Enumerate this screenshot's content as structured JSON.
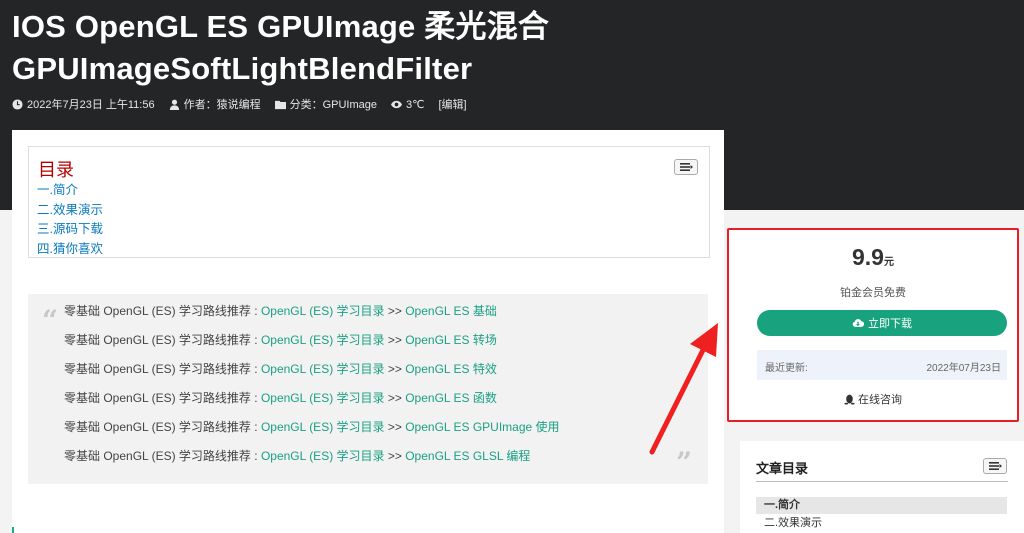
{
  "article": {
    "title_line1": "IOS OpenGL ES GPUImage 柔光混合",
    "title_line2": "GPUImageSoftLightBlendFilter",
    "meta": {
      "date": "2022年7月23日 上午11:56",
      "author": "作者：猿说编程",
      "category": "分类：GPUImage",
      "views": "3℃",
      "edit": "[编辑]"
    }
  },
  "toc": {
    "title": "目录",
    "items": [
      "一.简介",
      "二.效果演示",
      "三.源码下载",
      "四.猜你喜欢"
    ]
  },
  "quote": {
    "prefix": "零基础 OpenGL (ES) 学习路线推荐 : ",
    "link_main": "OpenGL (ES) 学习目录",
    "separator": " >> ",
    "lines": [
      "OpenGL ES 基础",
      "OpenGL ES 转场",
      "OpenGL ES 特效",
      "OpenGL ES 函数",
      "OpenGL ES GPUImage 使用",
      "OpenGL ES GLSL 编程"
    ]
  },
  "widget": {
    "price": "9.9",
    "currency": "元",
    "price_note": "铂金会员免费",
    "download_label": "立即下载",
    "update_label": "最近更新:",
    "update_value": "2022年07月23日",
    "consult_label": "在线咨询"
  },
  "sidebar_toc": {
    "title": "文章目录",
    "items": [
      "一.简介",
      "二.效果演示"
    ]
  },
  "icons": {
    "date": "clock-icon",
    "author": "user-icon",
    "category": "folder-icon",
    "views": "eye-icon",
    "download": "cloud-download-icon",
    "consult": "qq-penguin-icon",
    "toggle": "list-toggle-icon"
  },
  "colors": {
    "header_bg": "#232526",
    "link_blue": "#0a7abf",
    "link_green": "#1aa083",
    "button_green": "#18a37e",
    "toc_title_red": "#b50000",
    "highlight_red": "#ea1c24"
  }
}
